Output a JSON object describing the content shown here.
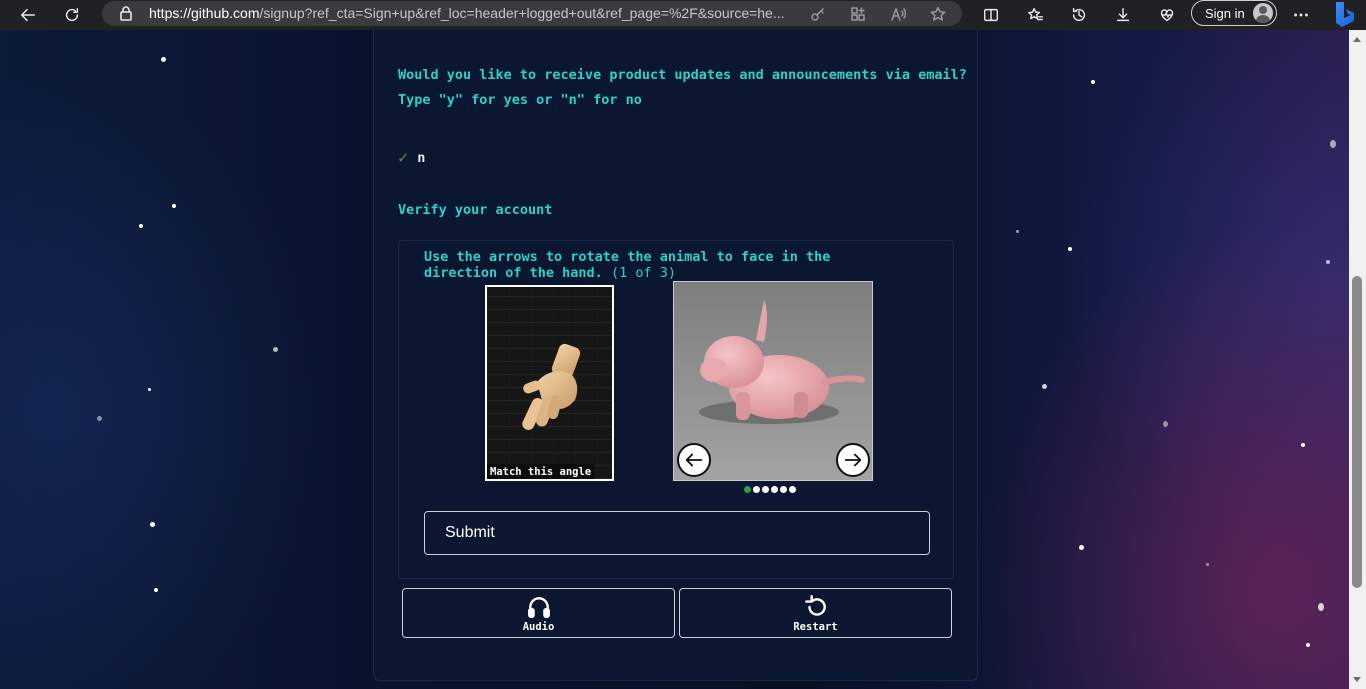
{
  "browser": {
    "url_host": "https://github.com",
    "url_rest": "/signup?ref_cta=Sign+up&ref_loc=header+logged+out&ref_page=%2F&source=he...",
    "signin_label": "Sign in"
  },
  "form": {
    "question_line1": "Would you like to receive product updates and announcements via email?",
    "question_line2": "Type \"y\" for yes or \"n\" for no",
    "answer": "n",
    "verify_heading": "Verify your account"
  },
  "captcha": {
    "instruction_bold": "Use the arrows to rotate the animal to face in the direction of the hand.",
    "instruction_count": "(1 of 3)",
    "match_label": "Match this angle",
    "dots_total": 6,
    "dots_active_index": 0,
    "submit_label": "Submit"
  },
  "actions": {
    "audio_label": "Audio",
    "restart_label": "Restart"
  },
  "colors": {
    "accent_teal": "#2ad2c9",
    "success_green": "#2ea043",
    "panel_bg": "#0b1731"
  }
}
